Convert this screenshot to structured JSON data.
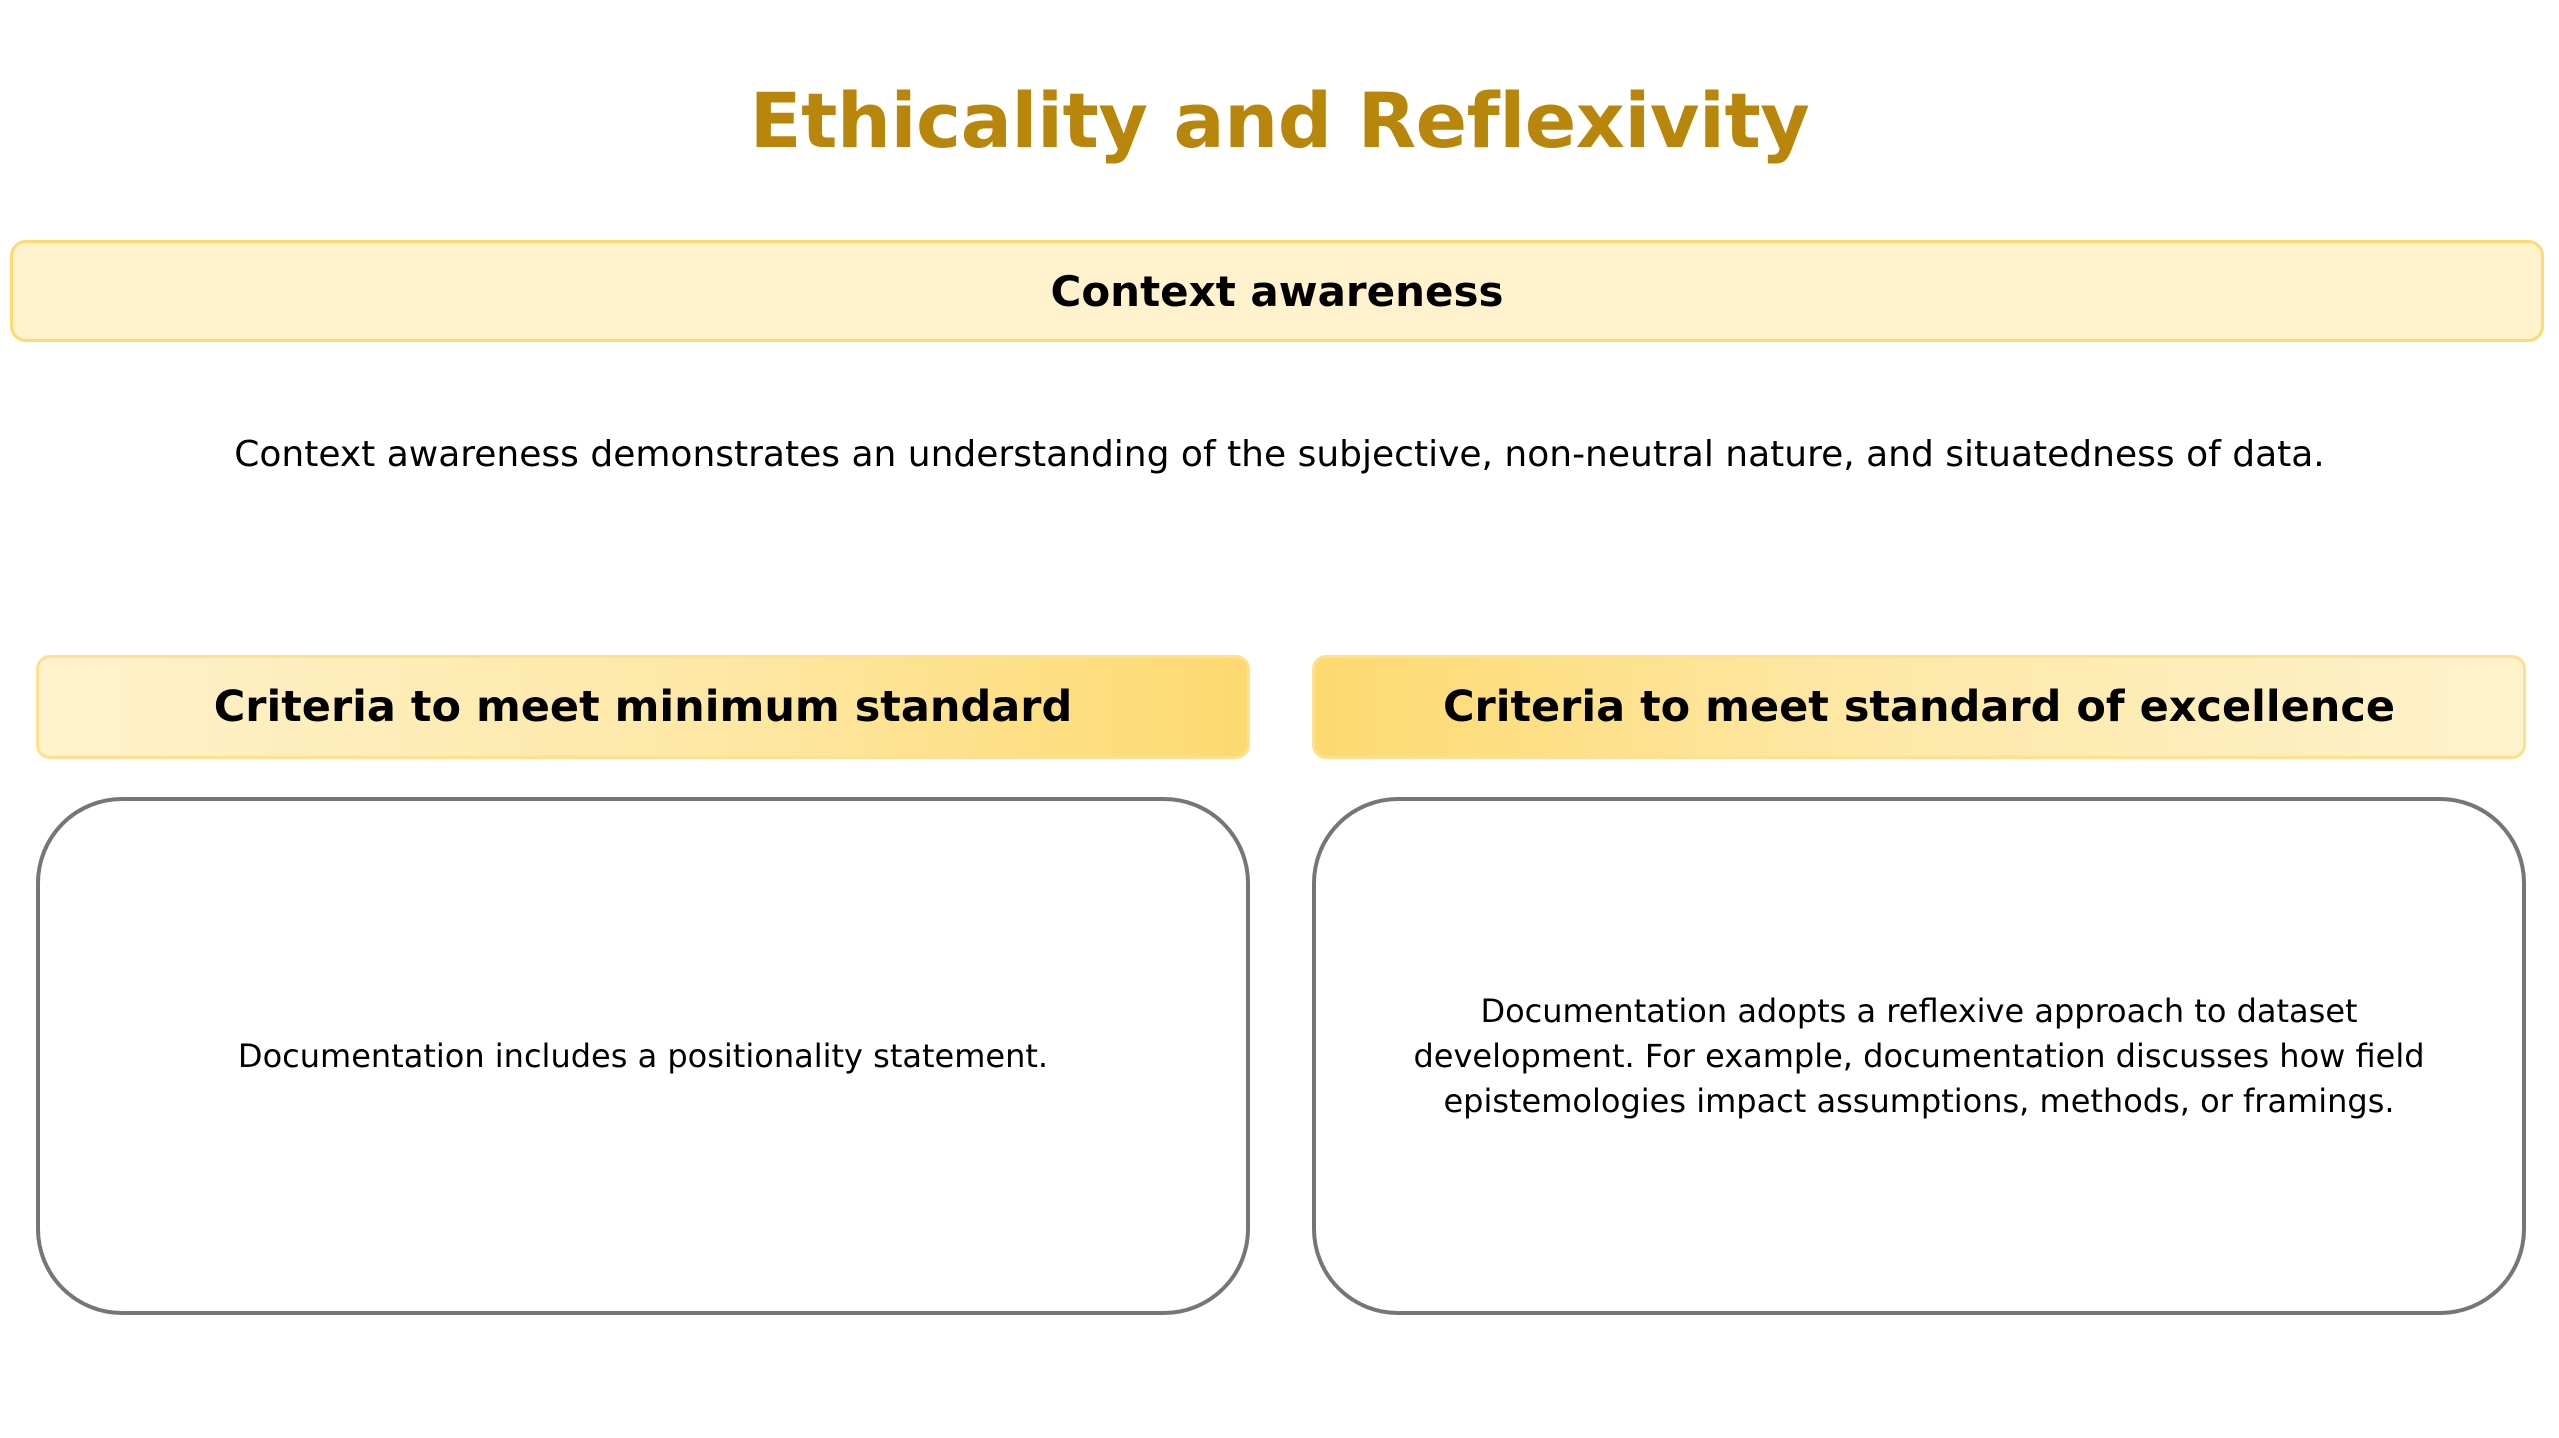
{
  "page": {
    "title": "Ethicality and Reflexivity",
    "title_color": "#b8860b"
  },
  "banner": {
    "label": "Context awareness",
    "background": "#fff2cc",
    "border": "#fdda72"
  },
  "description": "Context awareness demonstrates an understanding of the subjective, non-neutral nature, and situatedness of data.",
  "columns": [
    {
      "header": "Criteria to meet minimum standard",
      "body": "Documentation includes a positionality statement."
    },
    {
      "header": "Criteria to meet standard of excellence",
      "body": "Documentation adopts a reflexive approach to dataset development. For example, documentation discusses how field epistemologies impact assumptions, methods, or framings."
    }
  ],
  "colors": {
    "header_gradient_light": "#fff2cc",
    "header_gradient_dark": "#fdd96f",
    "card_border": "#767676"
  }
}
